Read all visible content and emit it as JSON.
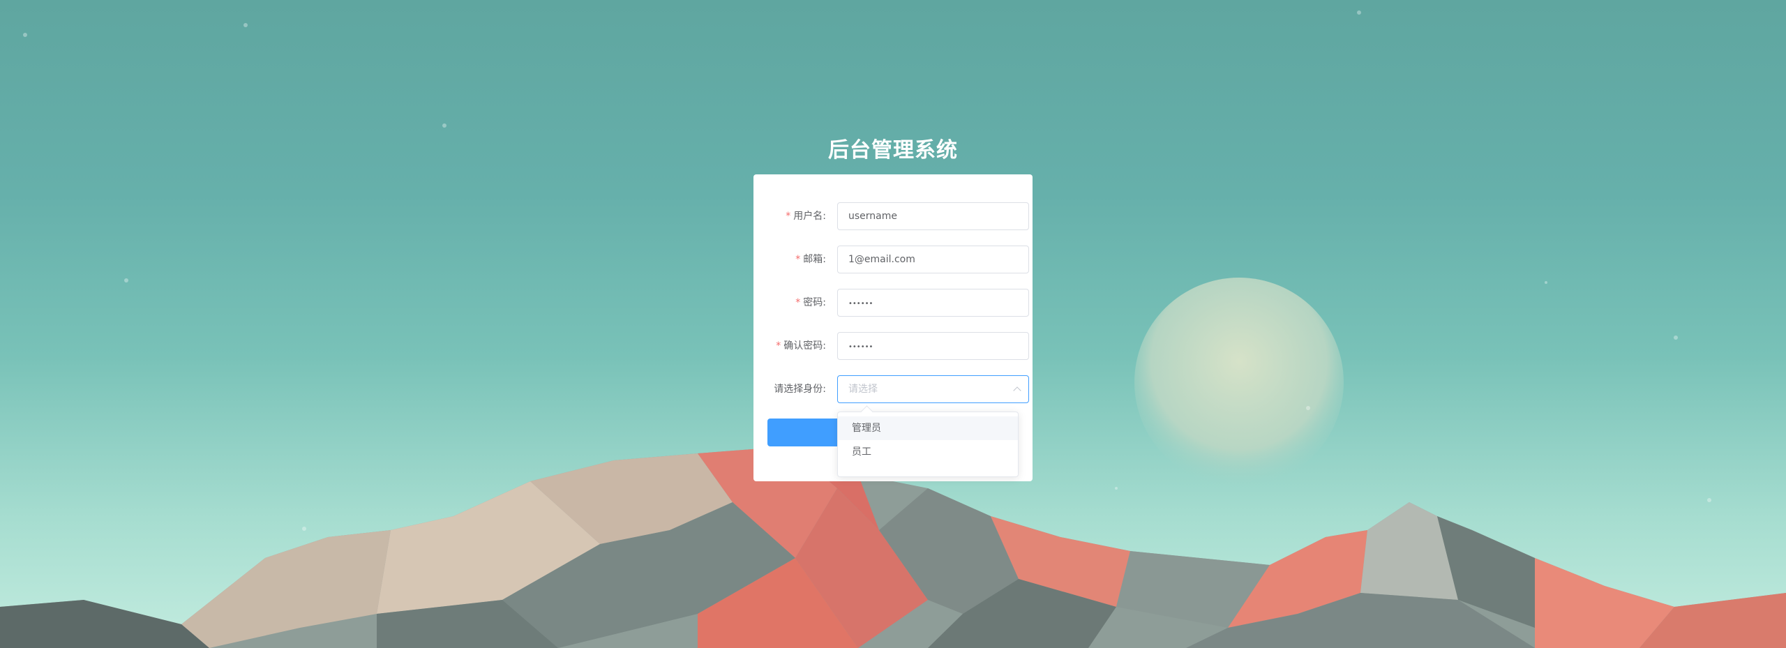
{
  "app": {
    "title": "后台管理系统"
  },
  "form": {
    "fields": [
      {
        "label": "用户名:",
        "required": true,
        "value": "username"
      },
      {
        "label": "邮箱:",
        "required": true,
        "value": "1@email.com"
      },
      {
        "label": "密码:",
        "required": true,
        "value": "••••••"
      },
      {
        "label": "确认密码:",
        "required": true,
        "value": "••••••"
      }
    ],
    "role": {
      "label": "请选择身份:",
      "placeholder": "请选择",
      "open": true
    },
    "required_mark": "*"
  },
  "dropdown": {
    "options": [
      {
        "label": "管理员",
        "hovered": true
      },
      {
        "label": "员工",
        "hovered": false
      }
    ]
  },
  "colors": {
    "primary": "#409eff",
    "required": "#f56c6c",
    "sky_top": "#5fa6a0",
    "sky_bottom": "#c3ecdf"
  }
}
